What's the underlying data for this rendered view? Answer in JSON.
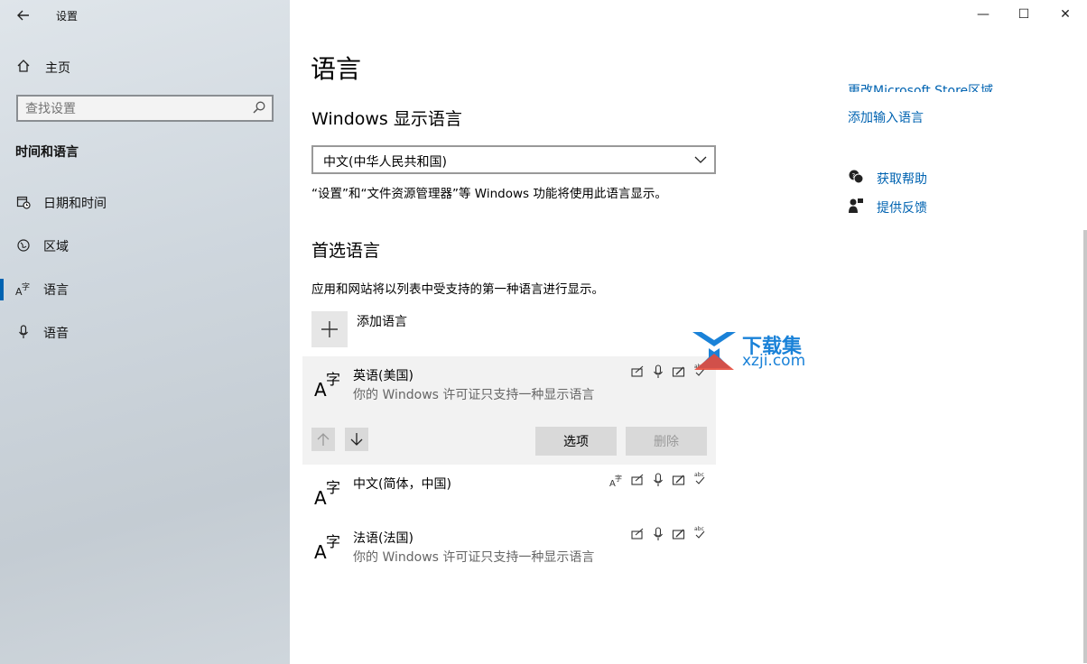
{
  "window": {
    "title": "设置",
    "controls": {
      "minimize": "—",
      "maximize": "☐",
      "close": "✕"
    }
  },
  "sidebar": {
    "home_label": "主页",
    "search": {
      "placeholder": "查找设置"
    },
    "section_title": "时间和语言",
    "items": [
      {
        "label": "日期和时间",
        "icon": "clock-calendar-icon"
      },
      {
        "label": "区域",
        "icon": "globe-region-icon"
      },
      {
        "label": "语言",
        "icon": "language-icon",
        "selected": true
      },
      {
        "label": "语音",
        "icon": "microphone-icon"
      }
    ]
  },
  "main": {
    "title": "语言",
    "display_language": {
      "heading": "Windows 显示语言",
      "selected": "中文(中华人民共和国)",
      "description": "“设置”和“文件资源管理器”等 Windows 功能将使用此语言显示。"
    },
    "preferred": {
      "heading": "首选语言",
      "description": "应用和网站将以列表中受支持的第一种语言进行显示。",
      "add_label": "添加语言",
      "languages": [
        {
          "name": "英语(美国)",
          "note": "你的 Windows 许可证只支持一种显示语言"
        },
        {
          "name": "中文(简体，中国)",
          "note": ""
        },
        {
          "name": "法语(法国)",
          "note": "你的 Windows 许可证只支持一种显示语言"
        }
      ],
      "options_label": "选项",
      "remove_label": "删除"
    }
  },
  "right_panel": {
    "link_store": "更改Microsoft Store区域",
    "link_input": "添加输入语言",
    "help": "获取帮助",
    "feedback": "提供反馈"
  },
  "watermark": {
    "brand": "下载集",
    "site": "xzji.com"
  },
  "colors": {
    "accent": "#0063b1",
    "watermark": "#1a82d8"
  }
}
